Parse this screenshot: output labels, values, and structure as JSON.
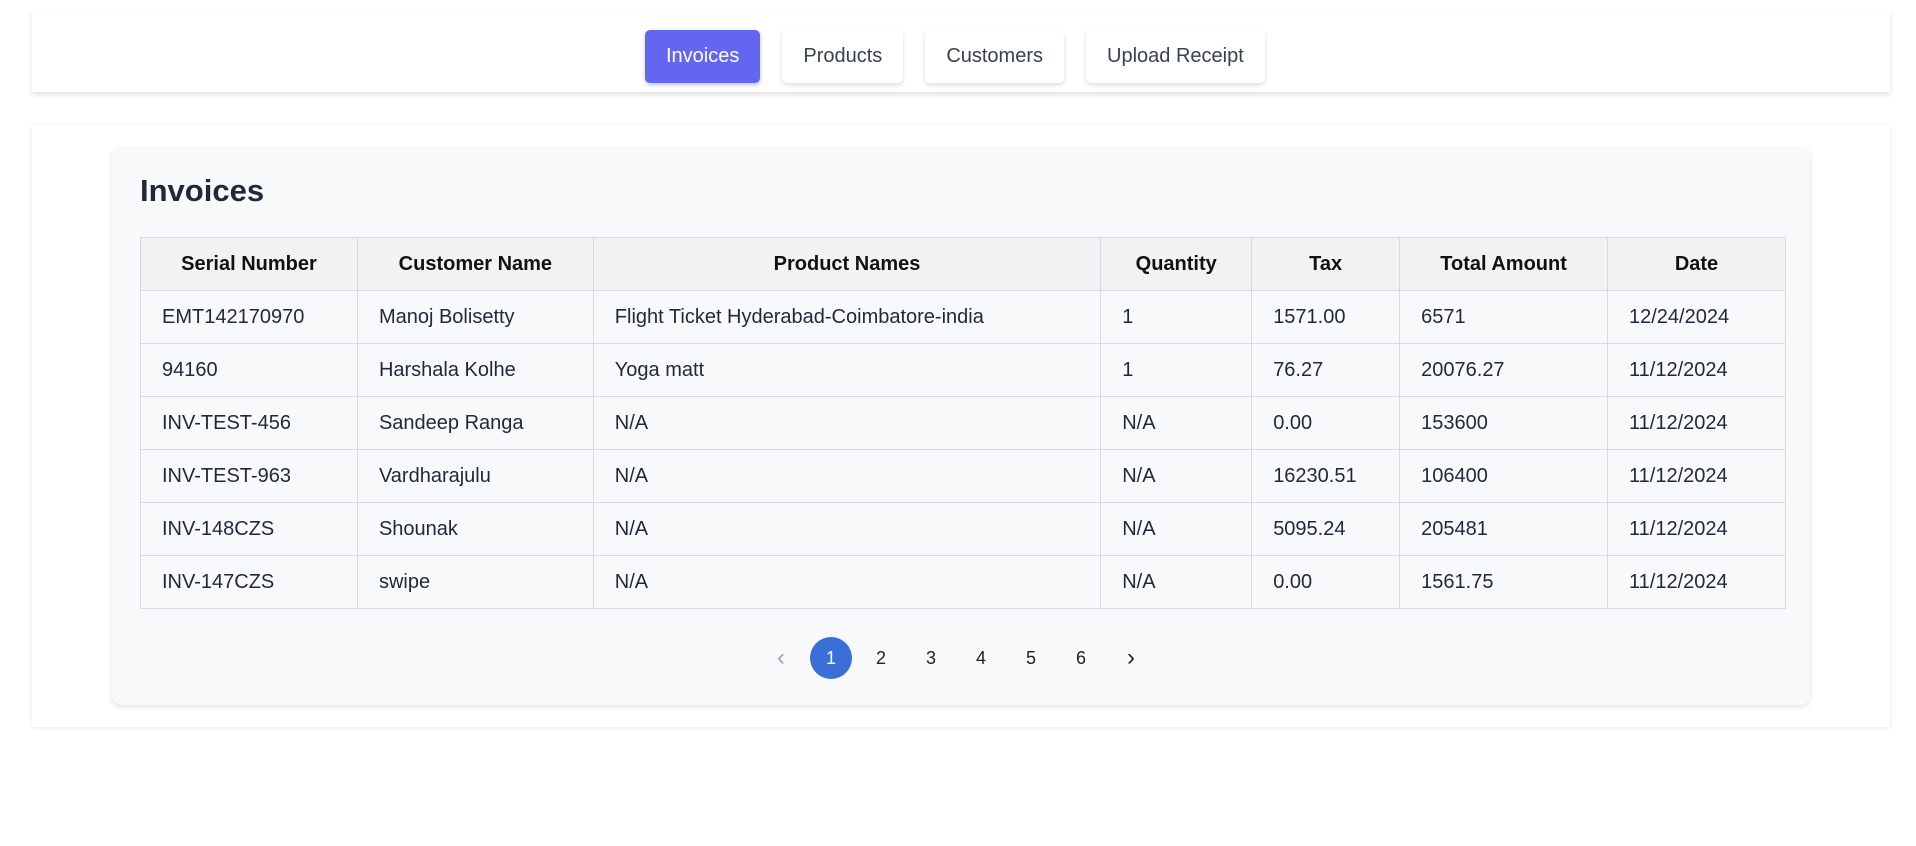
{
  "nav": {
    "tabs": [
      {
        "label": "Invoices",
        "active": true
      },
      {
        "label": "Products",
        "active": false
      },
      {
        "label": "Customers",
        "active": false
      },
      {
        "label": "Upload Receipt",
        "active": false
      }
    ]
  },
  "colors": {
    "active_tab": "#6366f1",
    "active_page": "#3a6fd8"
  },
  "invoices": {
    "title": "Invoices",
    "columns": [
      "Serial Number",
      "Customer Name",
      "Product Names",
      "Quantity",
      "Tax",
      "Total Amount",
      "Date"
    ],
    "rows": [
      [
        "EMT142170970",
        "Manoj Bolisetty",
        "Flight Ticket Hyderabad-Coimbatore-india",
        "1",
        "1571.00",
        "6571",
        "12/24/2024"
      ],
      [
        "94160",
        "Harshala Kolhe",
        "Yoga matt",
        "1",
        "76.27",
        "20076.27",
        "11/12/2024"
      ],
      [
        "INV-TEST-456",
        "Sandeep Ranga",
        "N/A",
        "N/A",
        "0.00",
        "153600",
        "11/12/2024"
      ],
      [
        "INV-TEST-963",
        "Vardharajulu",
        "N/A",
        "N/A",
        "16230.51",
        "106400",
        "11/12/2024"
      ],
      [
        "INV-148CZS",
        "Shounak",
        "N/A",
        "N/A",
        "5095.24",
        "205481",
        "11/12/2024"
      ],
      [
        "INV-147CZS",
        "swipe",
        "N/A",
        "N/A",
        "0.00",
        "1561.75",
        "11/12/2024"
      ]
    ]
  },
  "pagination": {
    "prev_icon": "chevron-left-icon",
    "next_icon": "chevron-right-icon",
    "prev_glyph": "‹",
    "next_glyph": "›",
    "pages": [
      "1",
      "2",
      "3",
      "4",
      "5",
      "6"
    ],
    "current": "1"
  }
}
